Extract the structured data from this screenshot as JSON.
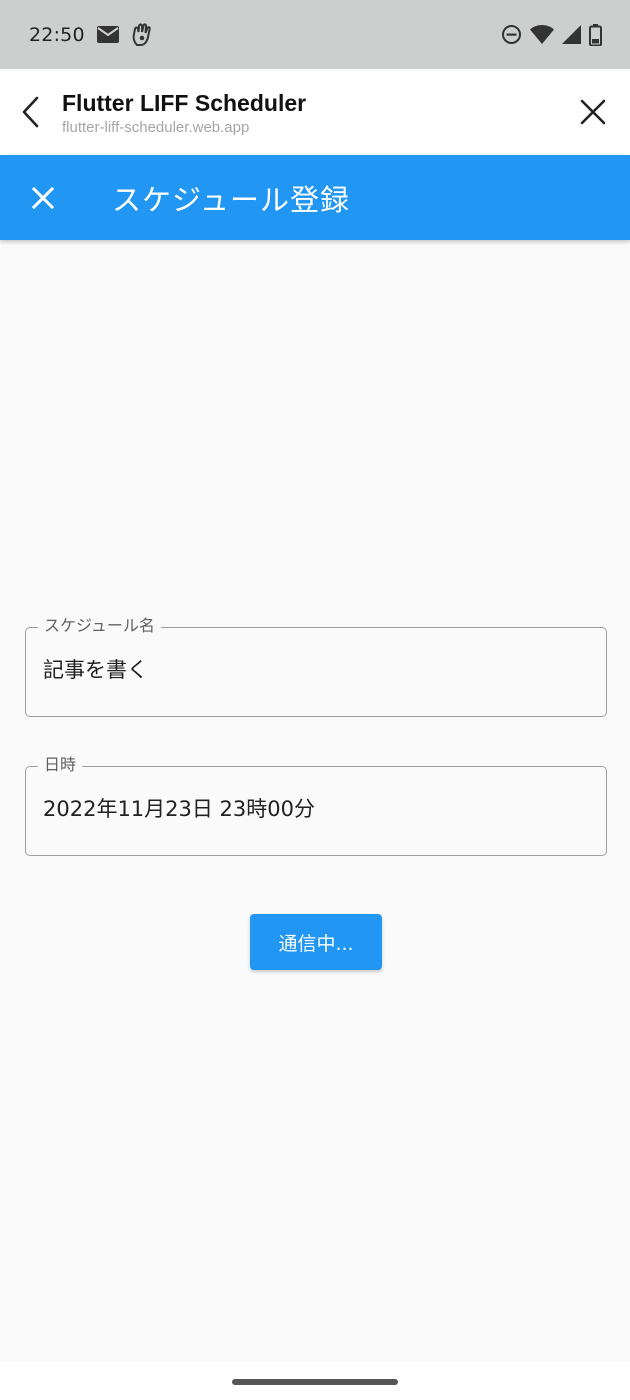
{
  "status_bar": {
    "time": "22:50",
    "left_icons": [
      "mail-icon",
      "hand-icon"
    ],
    "right_icons": [
      "dnd-icon",
      "wifi-icon",
      "signal-icon",
      "battery-icon"
    ]
  },
  "liff_header": {
    "title": "Flutter LIFF Scheduler",
    "url": "flutter-liff-scheduler.web.app"
  },
  "app_bar": {
    "title": "スケジュール登録",
    "color": "#2196f3"
  },
  "form": {
    "name_field": {
      "label": "スケジュール名",
      "value": "記事を書く"
    },
    "datetime_field": {
      "label": "日時",
      "value": "2022年11月23日 23時00分"
    },
    "submit_label": "通信中..."
  }
}
